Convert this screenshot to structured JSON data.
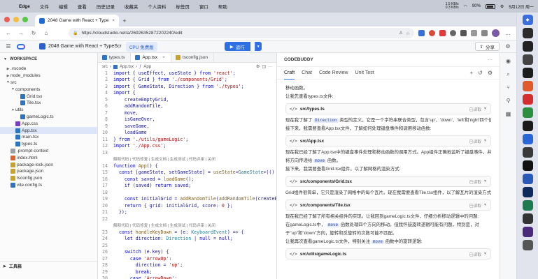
{
  "menubar": {
    "apple": "",
    "app_name": "Edge",
    "items": [
      "文件",
      "编辑",
      "查看",
      "历史记录",
      "收藏夹",
      "个人资料",
      "标签页",
      "窗口",
      "帮助"
    ],
    "battery": "90%",
    "network": "1.5 KB/s\n0.3 KB/s",
    "datetime": "5月12日 周一"
  },
  "browser": {
    "tab_title": "2048 Game with React + Type",
    "tab_close": "×",
    "new_tab": "+",
    "url": "https://cloudstudio.net/a/26926352872202240/edit"
  },
  "ide": {
    "project_name": "2048 Game with React + TypeScr",
    "plan_badge": "CPU 免费版",
    "run_label": "运行",
    "share_label": "分享"
  },
  "sidebar": {
    "workspace_label": "WORKSPACE",
    "tools_label": "工具箱",
    "tree": [
      {
        "name": ".vscode",
        "depth": 0,
        "kind": "folder",
        "open": false
      },
      {
        "name": "node_modules",
        "depth": 0,
        "kind": "folder",
        "open": false
      },
      {
        "name": "src",
        "depth": 0,
        "kind": "folder",
        "open": true
      },
      {
        "name": "components",
        "depth": 1,
        "kind": "folder",
        "open": true
      },
      {
        "name": "Grid.tsx",
        "depth": 2,
        "kind": "tsx"
      },
      {
        "name": "Tile.tsx",
        "depth": 2,
        "kind": "tsx"
      },
      {
        "name": "utils",
        "depth": 1,
        "kind": "folder",
        "open": true
      },
      {
        "name": "gameLogic.ts",
        "depth": 2,
        "kind": "ts"
      },
      {
        "name": "App.css",
        "depth": 1,
        "kind": "css"
      },
      {
        "name": "App.tsx",
        "depth": 1,
        "kind": "tsx",
        "selected": true
      },
      {
        "name": "main.tsx",
        "depth": 1,
        "kind": "tsx"
      },
      {
        "name": "types.ts",
        "depth": 1,
        "kind": "ts"
      },
      {
        "name": ".prompt-context",
        "depth": 0,
        "kind": "file"
      },
      {
        "name": "index.html",
        "depth": 0,
        "kind": "html"
      },
      {
        "name": "package-lock.json",
        "depth": 0,
        "kind": "json"
      },
      {
        "name": "package.json",
        "depth": 0,
        "kind": "json"
      },
      {
        "name": "tsconfig.json",
        "depth": 0,
        "kind": "json"
      },
      {
        "name": "vite.config.ts",
        "depth": 0,
        "kind": "ts"
      }
    ]
  },
  "editor": {
    "tabs": [
      {
        "label": "types.ts",
        "active": false
      },
      {
        "label": "App.tsx",
        "active": true
      },
      {
        "label": "tsconfig.json",
        "active": false
      }
    ],
    "breadcrumb": [
      "src",
      "App.tsx",
      "App"
    ],
    "lines": [
      {
        "n": "1",
        "html": "<span class='kw'>import</span> { useEffect, useState } <span class='kw'>from</span> <span class='str'>'react'</span>;"
      },
      {
        "n": "2",
        "html": "<span class='kw'>import</span> { Grid } <span class='kw'>from</span> <span class='str'>'./components/Grid'</span>;"
      },
      {
        "n": "3",
        "html": "<span class='kw'>import</span> { GameState, Direction } <span class='kw'>from</span> <span class='str'>'./types'</span>;"
      },
      {
        "n": "4",
        "html": "<span class='kw'>import</span> {"
      },
      {
        "n": "5",
        "html": "    createEmptyGrid,"
      },
      {
        "n": "6",
        "html": "    addRandomTile,"
      },
      {
        "n": "7",
        "html": "    move,"
      },
      {
        "n": "8",
        "html": "    isGameOver,"
      },
      {
        "n": "9",
        "html": "    saveGame,"
      },
      {
        "n": "10",
        "html": "    loadGame"
      },
      {
        "n": "11",
        "html": "} <span class='kw'>from</span> <span class='str'>'./utils/gameLogic'</span>;"
      },
      {
        "n": "12",
        "html": "<span class='kw'>import</span> <span class='str'>'./App.css'</span>;"
      },
      {
        "n": "13",
        "html": ""
      },
      {
        "n": "",
        "lens": true,
        "html": "解释代码 | 代码修复 | 生成文档 | 生成测试 | 代码评审 | 关闭"
      },
      {
        "n": "14",
        "html": "<span class='kw'>function</span> <span class='fn'>App</span>() {"
      },
      {
        "n": "15",
        "html": "  <span class='kw'>const</span> [gameState, setGameState] = <span class='fn'>useState</span>&lt;<span class='ty'>GameState</span>&gt;(()"
      },
      {
        "n": "16",
        "html": "    <span class='kw'>const</span> saved = <span class='fn'>loadGame</span>();"
      },
      {
        "n": "17",
        "html": "    <span class='kw'>if</span> (saved) <span class='kw'>return</span> saved;"
      },
      {
        "n": "18",
        "html": ""
      },
      {
        "n": "19",
        "html": "    <span class='kw'>const</span> initialGrid = <span class='fn'>addRandomTile</span>(<span class='fn'>addRandomTile</span>(createE"
      },
      {
        "n": "20",
        "html": "    <span class='kw'>return</span> { grid: initialGrid, score: <span class='str'>0</span> };"
      },
      {
        "n": "21",
        "html": "  });"
      },
      {
        "n": "22",
        "html": ""
      },
      {
        "n": "",
        "lens": true,
        "html": "解释代码 | 代码修复 | 生成文档 | 生成测试 | 代码评审 | 关闭"
      },
      {
        "n": "23",
        "html": "  <span class='kw'>const</span> <span class='fn'>handleKeyDown</span> = (e: <span class='ty'>KeyboardEvent</span>) =&gt; {"
      },
      {
        "n": "24",
        "html": "    <span class='kw'>let</span> direction: <span class='ty'>Direction</span> | <span class='kw'>null</span> = <span class='kw'>null</span>;"
      },
      {
        "n": "25",
        "html": ""
      },
      {
        "n": "26",
        "html": "    <span class='kw'>switch</span> (e.key) {"
      },
      {
        "n": "27",
        "html": "      <span class='kw'>case</span> <span class='str'>'ArrowUp'</span>:"
      },
      {
        "n": "28",
        "html": "        direction = <span class='str'>'up'</span>;"
      },
      {
        "n": "29",
        "html": "        <span class='kw'>break</span>;"
      },
      {
        "n": "30",
        "html": "      <span class='kw'>case</span> <span class='str'>'ArrowDown'</span>:"
      }
    ]
  },
  "panel": {
    "title": "CODEBUDDY",
    "more": "···",
    "tabs": [
      "Craft",
      "Chat",
      "Code Review",
      "Unit Test"
    ],
    "messages": [
      {
        "type": "text",
        "html": "移动函数。"
      },
      {
        "type": "text",
        "html": "让我先查看types.ts文件:"
      },
      {
        "type": "card",
        "name": "src/types.ts",
        "status": "已读取"
      },
      {
        "type": "text",
        "html": "现在我了解了 <span class='hl'>Direction</span> 类型的定义，它是一个字符串联合类型，包含'up'、'down'、'left'和'right'四个值。"
      },
      {
        "type": "text",
        "html": "接下来，我需要查看App.tsx文件，了解如何处理键盘事件和调用移动函数:"
      },
      {
        "type": "card",
        "name": "src/App.tsx",
        "status": "已读取"
      },
      {
        "type": "text",
        "html": "现在我已经了解了App.tsx中的键盘事件处理和移动函数的调用方式。App组件正确地监听了键盘事件，并根据按键"
      },
      {
        "type": "text",
        "html": "将方向传递给 <span class='hl'>move</span> 函数。"
      },
      {
        "type": "text",
        "html": "接下来，我需要查看Grid.tsx组件，以了解网格的渲染方式:"
      },
      {
        "type": "card",
        "name": "src/components/Grid.tsx",
        "status": "已读取"
      },
      {
        "type": "text",
        "html": "Grid组件很简单，它只是渲染了网格中的每个瓦片。现在我需要查看Tile.tsx组件，以了解瓦片的渲染方式:"
      },
      {
        "type": "card",
        "name": "src/components/Tile.tsx",
        "status": "已读取"
      },
      {
        "type": "text",
        "html": "现在我已经了解了所有相关组件的实现。让我回到gameLogic.ts文件，仔细分析移动逻辑中的问题:"
      },
      {
        "type": "text",
        "html": "在gameLogic.ts中， <span class='hl'>move</span> 函数处理四个方向的移动。但我怀疑旋转逻辑可能有问题，特别是，对"
      },
      {
        "type": "text",
        "html": "于\"up\"和\"down\"方向，旋转和反旋转的次数可能不匹配。"
      },
      {
        "type": "text",
        "html": "让我再次查看gameLogic.ts文件，特别关注 <span class='hl'>move</span> 函数中的旋转逻辑:"
      },
      {
        "type": "card",
        "name": "src/utils/gameLogic.ts",
        "status": "已读取"
      }
    ]
  },
  "icons": {
    "back": "back-arrow-icon",
    "forward": "forward-arrow-icon",
    "refresh": "refresh-icon",
    "home": "home-icon"
  },
  "colors": {
    "accent": "#2f6fe4",
    "selected_row": "#dde6f8"
  }
}
